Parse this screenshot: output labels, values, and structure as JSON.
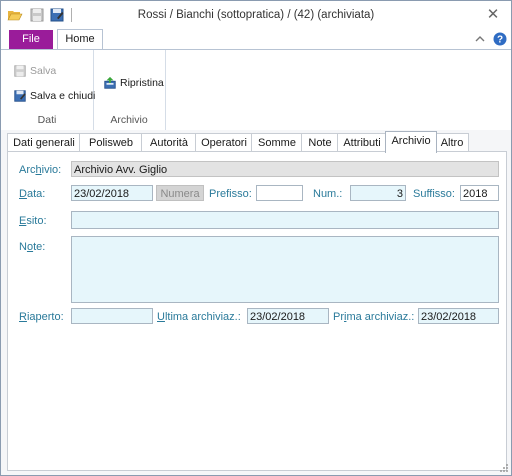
{
  "window": {
    "title": "Rossi / Bianchi (sottopratica) /  (42) (archiviata)",
    "close_glyph": "✕"
  },
  "ribbon": {
    "file_label": "File",
    "home_label": "Home",
    "groups": [
      {
        "label": "Dati",
        "buttons": [
          {
            "label": "Salva",
            "icon": "save-icon",
            "enabled": false
          },
          {
            "label": "Salva e chiudi",
            "icon": "save-close-icon",
            "enabled": true
          }
        ]
      },
      {
        "label": "Archivio",
        "buttons": [
          {
            "label": "Ripristina",
            "icon": "restore-icon",
            "enabled": true
          }
        ]
      }
    ]
  },
  "tabs": [
    {
      "label": "Dati generali"
    },
    {
      "label": "Polisweb"
    },
    {
      "label": "Autorità"
    },
    {
      "label": "Operatori"
    },
    {
      "label": "Somme"
    },
    {
      "label": "Note"
    },
    {
      "label": "Attributi"
    },
    {
      "label": "Archivio"
    },
    {
      "label": "Altro"
    }
  ],
  "active_tab": "Archivio",
  "form": {
    "archivio": {
      "pre": "Arc",
      "u": "h",
      "post": "ivio:",
      "value": "Archivio Avv. Giglio"
    },
    "data": {
      "u": "D",
      "post": "ata:",
      "value": "23/02/2018"
    },
    "numera_label": "Numera",
    "prefisso": {
      "label": "Prefisso:",
      "value": ""
    },
    "num": {
      "label": "Num.:",
      "value": "3"
    },
    "suffisso": {
      "label": "Suffisso:",
      "value": "2018"
    },
    "esito": {
      "u": "E",
      "post": "sito:",
      "value": ""
    },
    "note": {
      "pre": "N",
      "u": "o",
      "post": "te:",
      "value": ""
    },
    "riaperto": {
      "u": "R",
      "post": "iaperto:",
      "value": ""
    },
    "ultima": {
      "u": "U",
      "post": "ltima archiviaz.:",
      "value": "23/02/2018"
    },
    "prima": {
      "pre": "Pr",
      "u": "i",
      "post": "ma archiviaz.:",
      "value": "23/02/2018"
    }
  },
  "colors": {
    "file_tab": "#9a1c9a",
    "label": "#2a7a9a",
    "field_bg": "#e6f6fb"
  }
}
